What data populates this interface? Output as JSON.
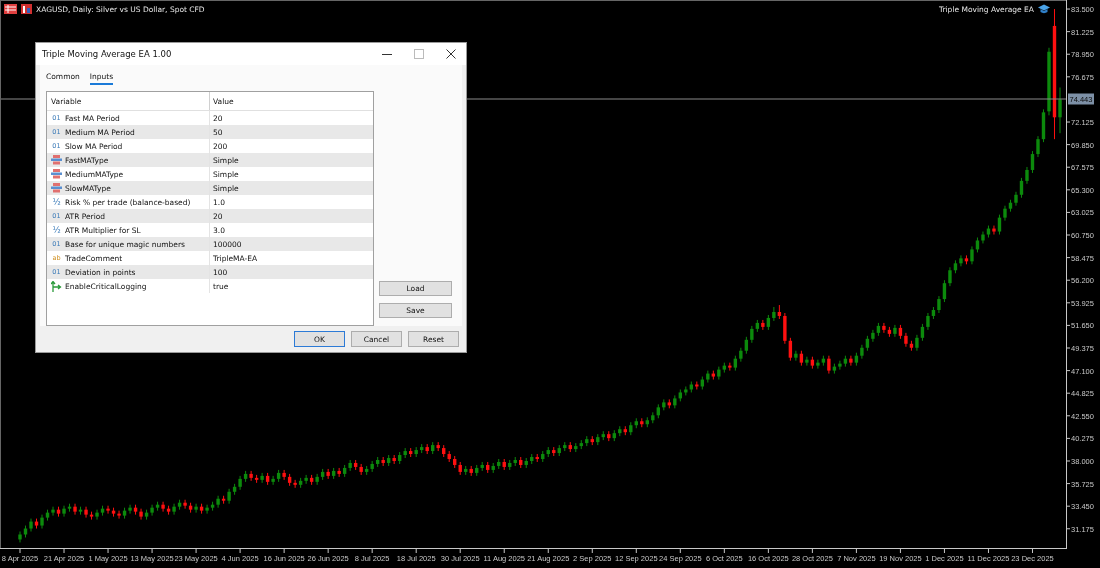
{
  "chart": {
    "title": "XAGUSD, Daily:  Silver vs US Dollar, Spot CFD",
    "expert_label": "Triple Moving Average EA",
    "chart_data": {
      "type": "candlestick",
      "ylim": [
        29.24,
        84.41
      ],
      "categories": [
        "8 Apr 2025",
        null,
        null,
        null,
        null,
        null,
        null,
        null,
        "21 Apr 2025",
        null,
        null,
        null,
        null,
        null,
        null,
        null,
        "1 May 2025",
        null,
        null,
        null,
        null,
        null,
        null,
        null,
        "13 May 2025",
        null,
        null,
        null,
        null,
        null,
        null,
        null,
        "23 May 2025",
        null,
        null,
        null,
        null,
        null,
        null,
        null,
        "4 Jun 2025",
        null,
        null,
        null,
        null,
        null,
        null,
        null,
        "16 Jun 2025",
        null,
        null,
        null,
        null,
        null,
        null,
        null,
        "26 Jun 2025",
        null,
        null,
        null,
        null,
        null,
        null,
        null,
        "8 Jul 2025",
        null,
        null,
        null,
        null,
        null,
        null,
        null,
        "18 Jul 2025",
        null,
        null,
        null,
        null,
        null,
        null,
        null,
        "30 Jul 2025",
        null,
        null,
        null,
        null,
        null,
        null,
        null,
        "11 Aug 2025",
        null,
        null,
        null,
        null,
        null,
        null,
        null,
        "21 Aug 2025",
        null,
        null,
        null,
        null,
        null,
        null,
        null,
        "2 Sep 2025",
        null,
        null,
        null,
        null,
        null,
        null,
        null,
        "12 Sep 2025",
        null,
        null,
        null,
        null,
        null,
        null,
        null,
        "24 Sep 2025",
        null,
        null,
        null,
        null,
        null,
        null,
        null,
        "6 Oct 2025",
        null,
        null,
        null,
        null,
        null,
        null,
        null,
        "16 Oct 2025",
        null,
        null,
        null,
        null,
        null,
        null,
        null,
        "28 Oct 2025",
        null,
        null,
        null,
        null,
        null,
        null,
        null,
        "7 Nov 2025",
        null,
        null,
        null,
        null,
        null,
        null,
        null,
        "19 Nov 2025",
        null,
        null,
        null,
        null,
        null,
        null,
        null,
        "1 Dec 2025",
        null,
        null,
        null,
        null,
        null,
        null,
        null,
        "11 Dec 2025",
        null,
        null,
        null,
        null,
        null,
        null,
        null,
        "23 Dec 2025",
        null,
        null,
        null,
        null,
        null
      ],
      "ohlc": [
        [
          30.1,
          30.9,
          29.8,
          30.6
        ],
        [
          30.6,
          31.5,
          30.3,
          31.2
        ],
        [
          31.2,
          32.2,
          30.9,
          31.9
        ],
        [
          31.9,
          32.2,
          31.2,
          31.5
        ],
        [
          31.5,
          32.6,
          31.2,
          32.3
        ],
        [
          32.3,
          33.1,
          32.0,
          32.8
        ],
        [
          32.8,
          33.4,
          32.5,
          33.1
        ],
        [
          33.1,
          33.4,
          32.4,
          32.7
        ],
        [
          32.7,
          33.5,
          32.4,
          33.2
        ],
        [
          33.2,
          33.7,
          32.9,
          33.4
        ],
        [
          33.4,
          33.7,
          32.6,
          32.9
        ],
        [
          32.9,
          33.4,
          32.6,
          33.1
        ],
        [
          33.1,
          33.4,
          32.3,
          32.6
        ],
        [
          32.6,
          32.9,
          32.1,
          32.4
        ],
        [
          32.4,
          33.1,
          32.1,
          32.8
        ],
        [
          32.8,
          33.5,
          32.5,
          33.2
        ],
        [
          33.2,
          33.5,
          32.7,
          33.0
        ],
        [
          33.0,
          33.3,
          32.4,
          32.7
        ],
        [
          32.7,
          33.0,
          32.2,
          32.5
        ],
        [
          32.5,
          33.3,
          32.2,
          33.0
        ],
        [
          33.0,
          33.6,
          32.7,
          33.3
        ],
        [
          33.3,
          33.6,
          32.6,
          32.9
        ],
        [
          32.9,
          33.2,
          32.1,
          32.4
        ],
        [
          32.4,
          33.1,
          32.1,
          32.8
        ],
        [
          32.8,
          33.6,
          32.5,
          33.3
        ],
        [
          33.3,
          33.9,
          33.0,
          33.6
        ],
        [
          33.6,
          33.9,
          32.9,
          33.2
        ],
        [
          33.2,
          33.5,
          32.6,
          32.9
        ],
        [
          32.9,
          33.7,
          32.6,
          33.4
        ],
        [
          33.4,
          34.1,
          33.1,
          33.8
        ],
        [
          33.8,
          34.1,
          33.2,
          33.5
        ],
        [
          33.5,
          33.8,
          32.8,
          33.1
        ],
        [
          33.1,
          33.7,
          32.8,
          33.4
        ],
        [
          33.4,
          33.7,
          32.7,
          33.0
        ],
        [
          33.0,
          33.6,
          32.7,
          33.3
        ],
        [
          33.3,
          33.9,
          33.0,
          33.6
        ],
        [
          33.6,
          34.5,
          33.3,
          34.2
        ],
        [
          34.2,
          34.5,
          33.7,
          34.0
        ],
        [
          34.0,
          35.2,
          33.7,
          34.9
        ],
        [
          34.9,
          35.7,
          34.6,
          35.4
        ],
        [
          35.4,
          36.5,
          35.1,
          36.2
        ],
        [
          36.2,
          37.0,
          35.9,
          36.7
        ],
        [
          36.7,
          37.0,
          36.0,
          36.3
        ],
        [
          36.3,
          36.6,
          35.8,
          36.1
        ],
        [
          36.1,
          36.8,
          35.8,
          36.5
        ],
        [
          36.5,
          36.8,
          35.6,
          35.9
        ],
        [
          35.9,
          36.5,
          35.6,
          36.2
        ],
        [
          36.2,
          37.1,
          35.9,
          36.8
        ],
        [
          36.8,
          37.1,
          36.1,
          36.4
        ],
        [
          36.4,
          36.7,
          35.5,
          35.8
        ],
        [
          35.8,
          36.1,
          35.3,
          35.6
        ],
        [
          35.6,
          36.3,
          35.3,
          36.0
        ],
        [
          36.0,
          36.6,
          35.7,
          36.3
        ],
        [
          36.3,
          36.6,
          35.6,
          35.9
        ],
        [
          35.9,
          36.7,
          35.6,
          36.4
        ],
        [
          36.4,
          37.2,
          36.1,
          36.9
        ],
        [
          36.9,
          37.2,
          36.2,
          36.5
        ],
        [
          36.5,
          37.3,
          36.2,
          37.0
        ],
        [
          37.0,
          37.3,
          36.4,
          36.7
        ],
        [
          36.7,
          37.6,
          36.4,
          37.3
        ],
        [
          37.3,
          38.1,
          37.0,
          37.8
        ],
        [
          37.8,
          38.1,
          37.1,
          37.4
        ],
        [
          37.4,
          37.7,
          36.6,
          36.9
        ],
        [
          36.9,
          37.5,
          36.6,
          37.2
        ],
        [
          37.2,
          38.0,
          36.9,
          37.7
        ],
        [
          37.7,
          38.4,
          37.4,
          38.1
        ],
        [
          38.1,
          38.4,
          37.5,
          37.8
        ],
        [
          37.8,
          38.6,
          37.5,
          38.3
        ],
        [
          38.3,
          38.6,
          37.7,
          38.0
        ],
        [
          38.0,
          38.9,
          37.7,
          38.6
        ],
        [
          38.6,
          39.3,
          38.3,
          39.0
        ],
        [
          39.0,
          39.3,
          38.4,
          38.7
        ],
        [
          38.7,
          39.4,
          38.4,
          39.1
        ],
        [
          39.1,
          39.7,
          38.8,
          39.4
        ],
        [
          39.4,
          39.7,
          38.7,
          39.0
        ],
        [
          39.0,
          39.9,
          38.7,
          39.6
        ],
        [
          39.6,
          39.9,
          39.0,
          39.3
        ],
        [
          39.3,
          39.6,
          38.4,
          38.7
        ],
        [
          38.7,
          39.0,
          37.9,
          38.2
        ],
        [
          38.2,
          38.5,
          37.3,
          37.6
        ],
        [
          37.6,
          37.9,
          36.6,
          36.9
        ],
        [
          36.9,
          37.5,
          36.6,
          37.2
        ],
        [
          37.2,
          37.5,
          36.5,
          36.8
        ],
        [
          36.8,
          37.6,
          36.5,
          37.3
        ],
        [
          37.3,
          37.9,
          37.0,
          37.6
        ],
        [
          37.6,
          37.9,
          36.8,
          37.1
        ],
        [
          37.1,
          37.8,
          36.8,
          37.5
        ],
        [
          37.5,
          38.2,
          37.2,
          37.9
        ],
        [
          37.9,
          38.2,
          37.1,
          37.4
        ],
        [
          37.4,
          38.1,
          37.1,
          37.8
        ],
        [
          37.8,
          38.4,
          37.5,
          38.1
        ],
        [
          38.1,
          38.4,
          37.3,
          37.6
        ],
        [
          37.6,
          38.3,
          37.3,
          38.0
        ],
        [
          38.0,
          38.7,
          37.7,
          38.4
        ],
        [
          38.4,
          38.7,
          37.9,
          38.2
        ],
        [
          38.2,
          39.0,
          37.9,
          38.7
        ],
        [
          38.7,
          39.4,
          38.4,
          39.1
        ],
        [
          39.1,
          39.4,
          38.5,
          38.8
        ],
        [
          38.8,
          39.6,
          38.5,
          39.3
        ],
        [
          39.3,
          39.9,
          39.0,
          39.6
        ],
        [
          39.6,
          39.9,
          38.9,
          39.2
        ],
        [
          39.2,
          39.8,
          38.9,
          39.5
        ],
        [
          39.5,
          40.1,
          39.2,
          39.8
        ],
        [
          39.8,
          40.5,
          39.5,
          40.2
        ],
        [
          40.2,
          40.5,
          39.6,
          39.9
        ],
        [
          39.9,
          40.7,
          39.6,
          40.4
        ],
        [
          40.4,
          41.0,
          40.1,
          40.7
        ],
        [
          40.7,
          41.0,
          40.0,
          40.3
        ],
        [
          40.3,
          41.1,
          40.0,
          40.8
        ],
        [
          40.8,
          41.5,
          40.5,
          41.2
        ],
        [
          41.2,
          41.5,
          40.6,
          40.9
        ],
        [
          40.9,
          41.9,
          40.6,
          41.6
        ],
        [
          41.6,
          42.3,
          41.3,
          42.0
        ],
        [
          42.0,
          42.3,
          41.4,
          41.7
        ],
        [
          41.7,
          42.4,
          41.4,
          42.1
        ],
        [
          42.1,
          42.9,
          41.8,
          42.6
        ],
        [
          42.6,
          43.7,
          42.3,
          43.4
        ],
        [
          43.4,
          44.2,
          43.1,
          43.9
        ],
        [
          43.9,
          44.2,
          43.3,
          43.6
        ],
        [
          43.6,
          44.6,
          43.3,
          44.3
        ],
        [
          44.3,
          45.2,
          44.0,
          44.9
        ],
        [
          44.9,
          45.5,
          44.6,
          45.2
        ],
        [
          45.2,
          46.0,
          44.9,
          45.7
        ],
        [
          45.7,
          46.0,
          45.2,
          45.5
        ],
        [
          45.5,
          46.5,
          45.2,
          46.2
        ],
        [
          46.2,
          47.1,
          45.9,
          46.8
        ],
        [
          46.8,
          47.1,
          46.2,
          46.5
        ],
        [
          46.5,
          47.5,
          46.2,
          47.2
        ],
        [
          47.2,
          47.9,
          46.9,
          47.6
        ],
        [
          47.6,
          47.9,
          47.1,
          47.4
        ],
        [
          47.4,
          48.6,
          47.1,
          48.3
        ],
        [
          48.3,
          49.4,
          48.0,
          49.1
        ],
        [
          49.1,
          50.5,
          48.8,
          50.2
        ],
        [
          50.2,
          51.6,
          49.9,
          51.3
        ],
        [
          51.3,
          52.2,
          51.0,
          51.9
        ],
        [
          51.9,
          52.2,
          51.2,
          51.5
        ],
        [
          51.5,
          52.7,
          51.2,
          52.4
        ],
        [
          52.4,
          53.5,
          52.1,
          53.0
        ],
        [
          53.0,
          53.7,
          52.3,
          52.6
        ],
        [
          52.6,
          52.9,
          49.8,
          50.1
        ],
        [
          50.1,
          50.4,
          48.1,
          48.4
        ],
        [
          48.4,
          49.1,
          48.1,
          48.8
        ],
        [
          48.8,
          49.1,
          47.6,
          47.9
        ],
        [
          47.9,
          48.5,
          47.6,
          48.2
        ],
        [
          48.2,
          48.5,
          47.3,
          47.6
        ],
        [
          47.6,
          48.2,
          47.3,
          47.9
        ],
        [
          47.9,
          48.6,
          47.6,
          48.3
        ],
        [
          48.3,
          48.6,
          46.8,
          47.1
        ],
        [
          47.1,
          47.8,
          46.8,
          47.5
        ],
        [
          47.5,
          48.1,
          47.2,
          47.8
        ],
        [
          47.8,
          48.6,
          47.5,
          48.3
        ],
        [
          48.3,
          48.6,
          47.6,
          47.9
        ],
        [
          47.9,
          48.9,
          47.6,
          48.6
        ],
        [
          48.6,
          49.7,
          48.3,
          49.4
        ],
        [
          49.4,
          50.6,
          49.1,
          50.3
        ],
        [
          50.3,
          51.2,
          50.0,
          50.9
        ],
        [
          50.9,
          51.9,
          50.6,
          51.6
        ],
        [
          51.6,
          51.9,
          50.9,
          51.2
        ],
        [
          51.2,
          51.5,
          50.5,
          50.8
        ],
        [
          50.8,
          51.7,
          50.5,
          51.4
        ],
        [
          51.4,
          51.7,
          50.3,
          50.6
        ],
        [
          50.6,
          50.9,
          49.5,
          49.8
        ],
        [
          49.8,
          50.1,
          49.1,
          49.4
        ],
        [
          49.4,
          50.7,
          49.1,
          50.4
        ],
        [
          50.4,
          51.8,
          50.1,
          51.5
        ],
        [
          51.5,
          52.9,
          51.2,
          52.6
        ],
        [
          52.6,
          53.5,
          52.3,
          53.2
        ],
        [
          53.2,
          54.6,
          52.9,
          54.3
        ],
        [
          54.3,
          56.2,
          54.0,
          55.9
        ],
        [
          55.9,
          57.5,
          55.6,
          57.2
        ],
        [
          57.2,
          58.2,
          56.9,
          57.9
        ],
        [
          57.9,
          58.7,
          57.6,
          58.4
        ],
        [
          58.4,
          58.7,
          57.8,
          58.1
        ],
        [
          58.1,
          59.6,
          57.8,
          59.3
        ],
        [
          59.3,
          60.5,
          59.0,
          60.2
        ],
        [
          60.2,
          61.1,
          59.9,
          60.8
        ],
        [
          60.8,
          61.7,
          60.5,
          61.4
        ],
        [
          61.4,
          61.7,
          60.8,
          61.1
        ],
        [
          61.1,
          62.8,
          60.8,
          62.5
        ],
        [
          62.5,
          63.7,
          62.2,
          63.4
        ],
        [
          63.4,
          64.3,
          63.1,
          64.0
        ],
        [
          64.0,
          65.1,
          63.7,
          64.8
        ],
        [
          64.8,
          66.5,
          64.5,
          66.2
        ],
        [
          66.2,
          67.6,
          65.9,
          67.3
        ],
        [
          67.3,
          69.2,
          67.0,
          68.9
        ],
        [
          68.9,
          70.7,
          68.6,
          70.4
        ],
        [
          70.4,
          73.4,
          70.1,
          73.1
        ],
        [
          73.2,
          79.6,
          72.8,
          79.2
        ],
        [
          81.8,
          83.5,
          70.4,
          72.6
        ],
        [
          72.6,
          75.6,
          71.0,
          74.4
        ]
      ],
      "yticks": [
        {
          "value": 83.5,
          "label": "83.500"
        },
        {
          "value": 81.225,
          "label": "81.225"
        },
        {
          "value": 78.95,
          "label": "78.950"
        },
        {
          "value": 76.675,
          "label": "76.675"
        },
        {
          "value": 72.125,
          "label": "72.125"
        },
        {
          "value": 69.85,
          "label": "69.850"
        },
        {
          "value": 67.575,
          "label": "67.575"
        },
        {
          "value": 65.3,
          "label": "65.300"
        },
        {
          "value": 63.025,
          "label": "63.025"
        },
        {
          "value": 60.75,
          "label": "60.750"
        },
        {
          "value": 58.475,
          "label": "58.475"
        },
        {
          "value": 56.2,
          "label": "56.200"
        },
        {
          "value": 53.925,
          "label": "53.925"
        },
        {
          "value": 51.65,
          "label": "51.650"
        },
        {
          "value": 49.375,
          "label": "49.375"
        },
        {
          "value": 47.1,
          "label": "47.100"
        },
        {
          "value": 44.825,
          "label": "44.825"
        },
        {
          "value": 42.55,
          "label": "42.550"
        },
        {
          "value": 40.275,
          "label": "40.275"
        },
        {
          "value": 38.0,
          "label": "38.000"
        },
        {
          "value": 35.725,
          "label": "35.725"
        },
        {
          "value": 33.45,
          "label": "33.450"
        },
        {
          "value": 31.175,
          "label": "31.175"
        }
      ],
      "ref_lines": [
        {
          "axis": "y",
          "value": 74.443,
          "label": "74.443"
        }
      ]
    }
  },
  "dialog": {
    "title": "Triple Moving Average EA 1.00",
    "tabs": [
      {
        "label": "Common",
        "selected": false
      },
      {
        "label": "Inputs",
        "selected": true
      }
    ],
    "table": {
      "columns": [
        "Variable",
        "Value"
      ],
      "rows": [
        {
          "kind": "int",
          "icon": "01",
          "variable": "Fast MA Period",
          "value": "20"
        },
        {
          "kind": "int",
          "icon": "01",
          "variable": "Medium MA Period",
          "value": "50"
        },
        {
          "kind": "int",
          "icon": "01",
          "variable": "Slow MA Period",
          "value": "200"
        },
        {
          "kind": "enum",
          "variable": "FastMAType",
          "value": "Simple"
        },
        {
          "kind": "enum",
          "variable": "MediumMAType",
          "value": "Simple"
        },
        {
          "kind": "enum",
          "variable": "SlowMAType",
          "value": "Simple"
        },
        {
          "kind": "double",
          "icon": "½",
          "variable": "Risk % per trade (balance-based)",
          "value": "1.0"
        },
        {
          "kind": "int",
          "icon": "01",
          "variable": "ATR Period",
          "value": "20"
        },
        {
          "kind": "double",
          "icon": "½",
          "variable": "ATR Multiplier for SL",
          "value": "3.0"
        },
        {
          "kind": "int",
          "icon": "01",
          "variable": "Base for unique magic numbers",
          "value": "100000"
        },
        {
          "kind": "string",
          "icon": "ab",
          "variable": "TradeComment",
          "value": "TripleMA-EA"
        },
        {
          "kind": "int",
          "icon": "01",
          "variable": "Deviation in points",
          "value": "100"
        },
        {
          "kind": "bool",
          "variable": "EnableCriticalLogging",
          "value": "true"
        }
      ]
    },
    "side_buttons": [
      "Load",
      "Save"
    ],
    "buttons": [
      {
        "label": "OK",
        "default": true
      },
      {
        "label": "Cancel",
        "default": false
      },
      {
        "label": "Reset",
        "default": false
      }
    ]
  }
}
